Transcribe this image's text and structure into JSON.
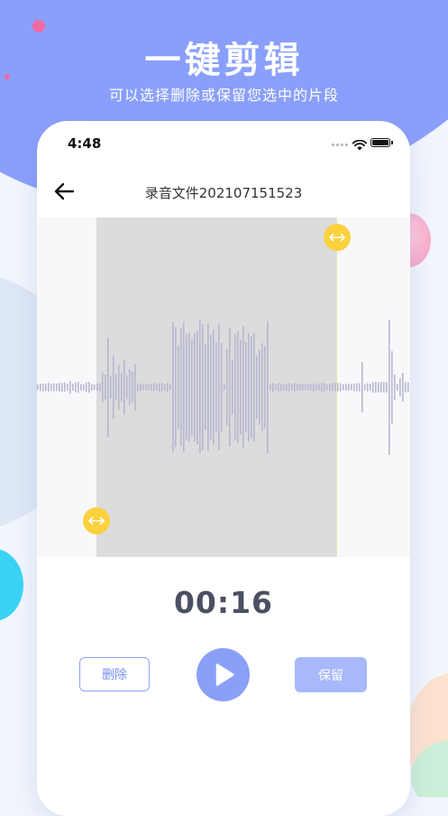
{
  "hero": {
    "title": "一键剪辑",
    "subtitle": "可以选择删除或保留您选中的片段"
  },
  "status_bar": {
    "time": "4:48",
    "icons": [
      "signal-icon",
      "wifi-icon",
      "battery-icon"
    ]
  },
  "nav": {
    "back_icon": "back-arrow-icon",
    "title": "录音文件202107151523"
  },
  "editor": {
    "handle_icon": "horizontal-resize-arrows-icon",
    "colors": {
      "selection": "#dcdcdd",
      "waveform": "#b7b7d3",
      "handle": "#fbd13e"
    }
  },
  "player": {
    "elapsed": "00:16",
    "delete_label": "删除",
    "play_icon": "play-icon",
    "keep_label": "保留"
  },
  "theme": {
    "accent": "#8aa0f8",
    "hero_background": "#8a9ffb"
  }
}
